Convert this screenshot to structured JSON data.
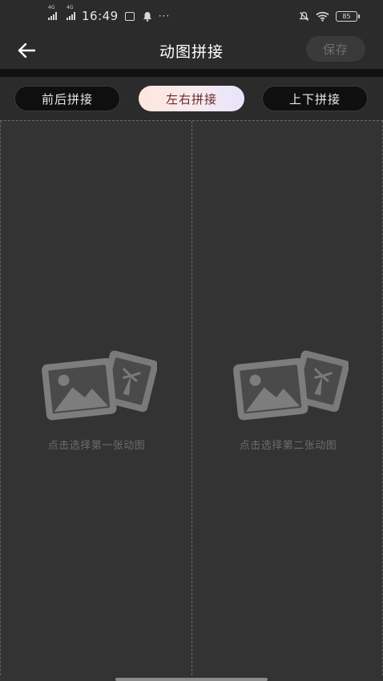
{
  "status_bar": {
    "net_1": "4G",
    "net_2": "4G",
    "time": "16:49",
    "more": "···",
    "battery": "85"
  },
  "app_bar": {
    "title": "动图拼接",
    "save_label": "保存"
  },
  "tabs": [
    {
      "label": "前后拼接",
      "active": false
    },
    {
      "label": "左右拼接",
      "active": true
    },
    {
      "label": "上下拼接",
      "active": false
    }
  ],
  "panels": {
    "left_label": "点击选择第一张动图",
    "right_label": "点击选择第二张动图"
  },
  "colors": {
    "background": "#2b2b2b",
    "canvas": "#333333",
    "active_tab_gradient_start": "#fde6dd",
    "active_tab_gradient_end": "#e6e4fb",
    "placeholder_text": "#6c6c6c"
  }
}
